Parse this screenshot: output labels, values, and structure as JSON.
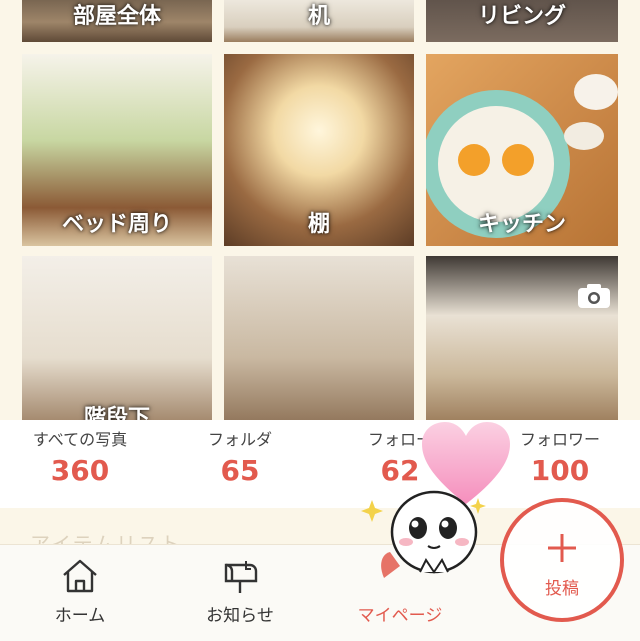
{
  "tiles": [
    {
      "label": "部屋全体"
    },
    {
      "label": "机"
    },
    {
      "label": "リビング"
    },
    {
      "label": "ベッド周り"
    },
    {
      "label": "棚"
    },
    {
      "label": "キッチン"
    },
    {
      "label": "階段下"
    },
    {
      "label": ""
    },
    {
      "label": ""
    }
  ],
  "stats": [
    {
      "label": "すべての写真",
      "value": "360"
    },
    {
      "label": "フォルダ",
      "value": "65"
    },
    {
      "label": "フォロー",
      "value": "62"
    },
    {
      "label": "フォロワー",
      "value": "100"
    }
  ],
  "section_title": "アイテムリスト",
  "tabs": [
    {
      "label": "ホーム",
      "icon": "house-icon"
    },
    {
      "label": "お知らせ",
      "icon": "mailbox-icon"
    },
    {
      "label": "マイページ",
      "icon": "person-icon"
    }
  ],
  "post_button": {
    "label": "投稿"
  },
  "colors": {
    "accent": "#e25a4e",
    "background": "#fbf6e8",
    "heart": "#f7a7c9"
  }
}
